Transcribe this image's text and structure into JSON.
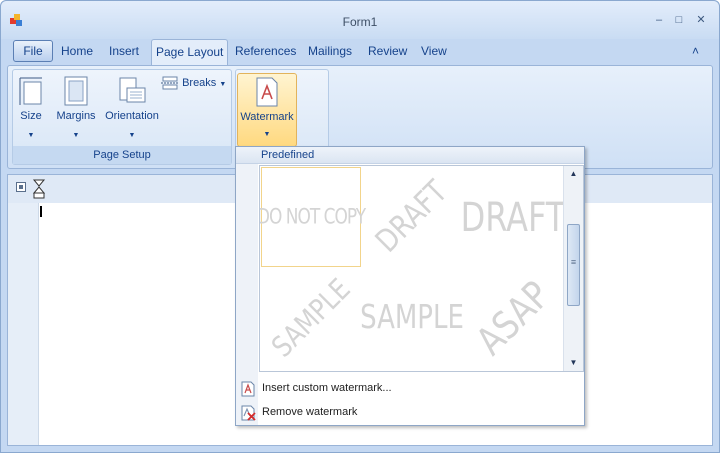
{
  "window": {
    "title": "Form1",
    "minimize": "–",
    "maximize": "□",
    "close": "✕"
  },
  "tabs": {
    "file": "File",
    "items": [
      "Home",
      "Insert",
      "Page Layout",
      "References",
      "Mailings",
      "Review",
      "View"
    ],
    "active": "Page Layout",
    "collapse": "˄"
  },
  "page_setup": {
    "group_label": "Page Setup",
    "size": "Size",
    "margins": "Margins",
    "orientation": "Orientation",
    "breaks": "Breaks",
    "arrow": "▼"
  },
  "watermark_button": {
    "label": "Watermark",
    "arrow": "▼"
  },
  "watermark_menu": {
    "header": "Predefined",
    "thumbnails": [
      {
        "text": "DO NOT COPY",
        "style": "straight"
      },
      {
        "text": "DRAFT",
        "style": "diagonal"
      },
      {
        "text": "DRAFT",
        "style": "straight"
      },
      {
        "text": "SAMPLE",
        "style": "diagonal"
      },
      {
        "text": "SAMPLE",
        "style": "straight"
      },
      {
        "text": "ASAP",
        "style": "diagonal"
      }
    ],
    "scroll_up": "▲",
    "scroll_down": "▼",
    "insert_custom": "Insert custom watermark...",
    "remove": "Remove watermark"
  },
  "colors": {
    "ribbon_text": "#15428b",
    "watermark_gray": "#d4d4d4",
    "hover_orange": "#ffd980"
  }
}
